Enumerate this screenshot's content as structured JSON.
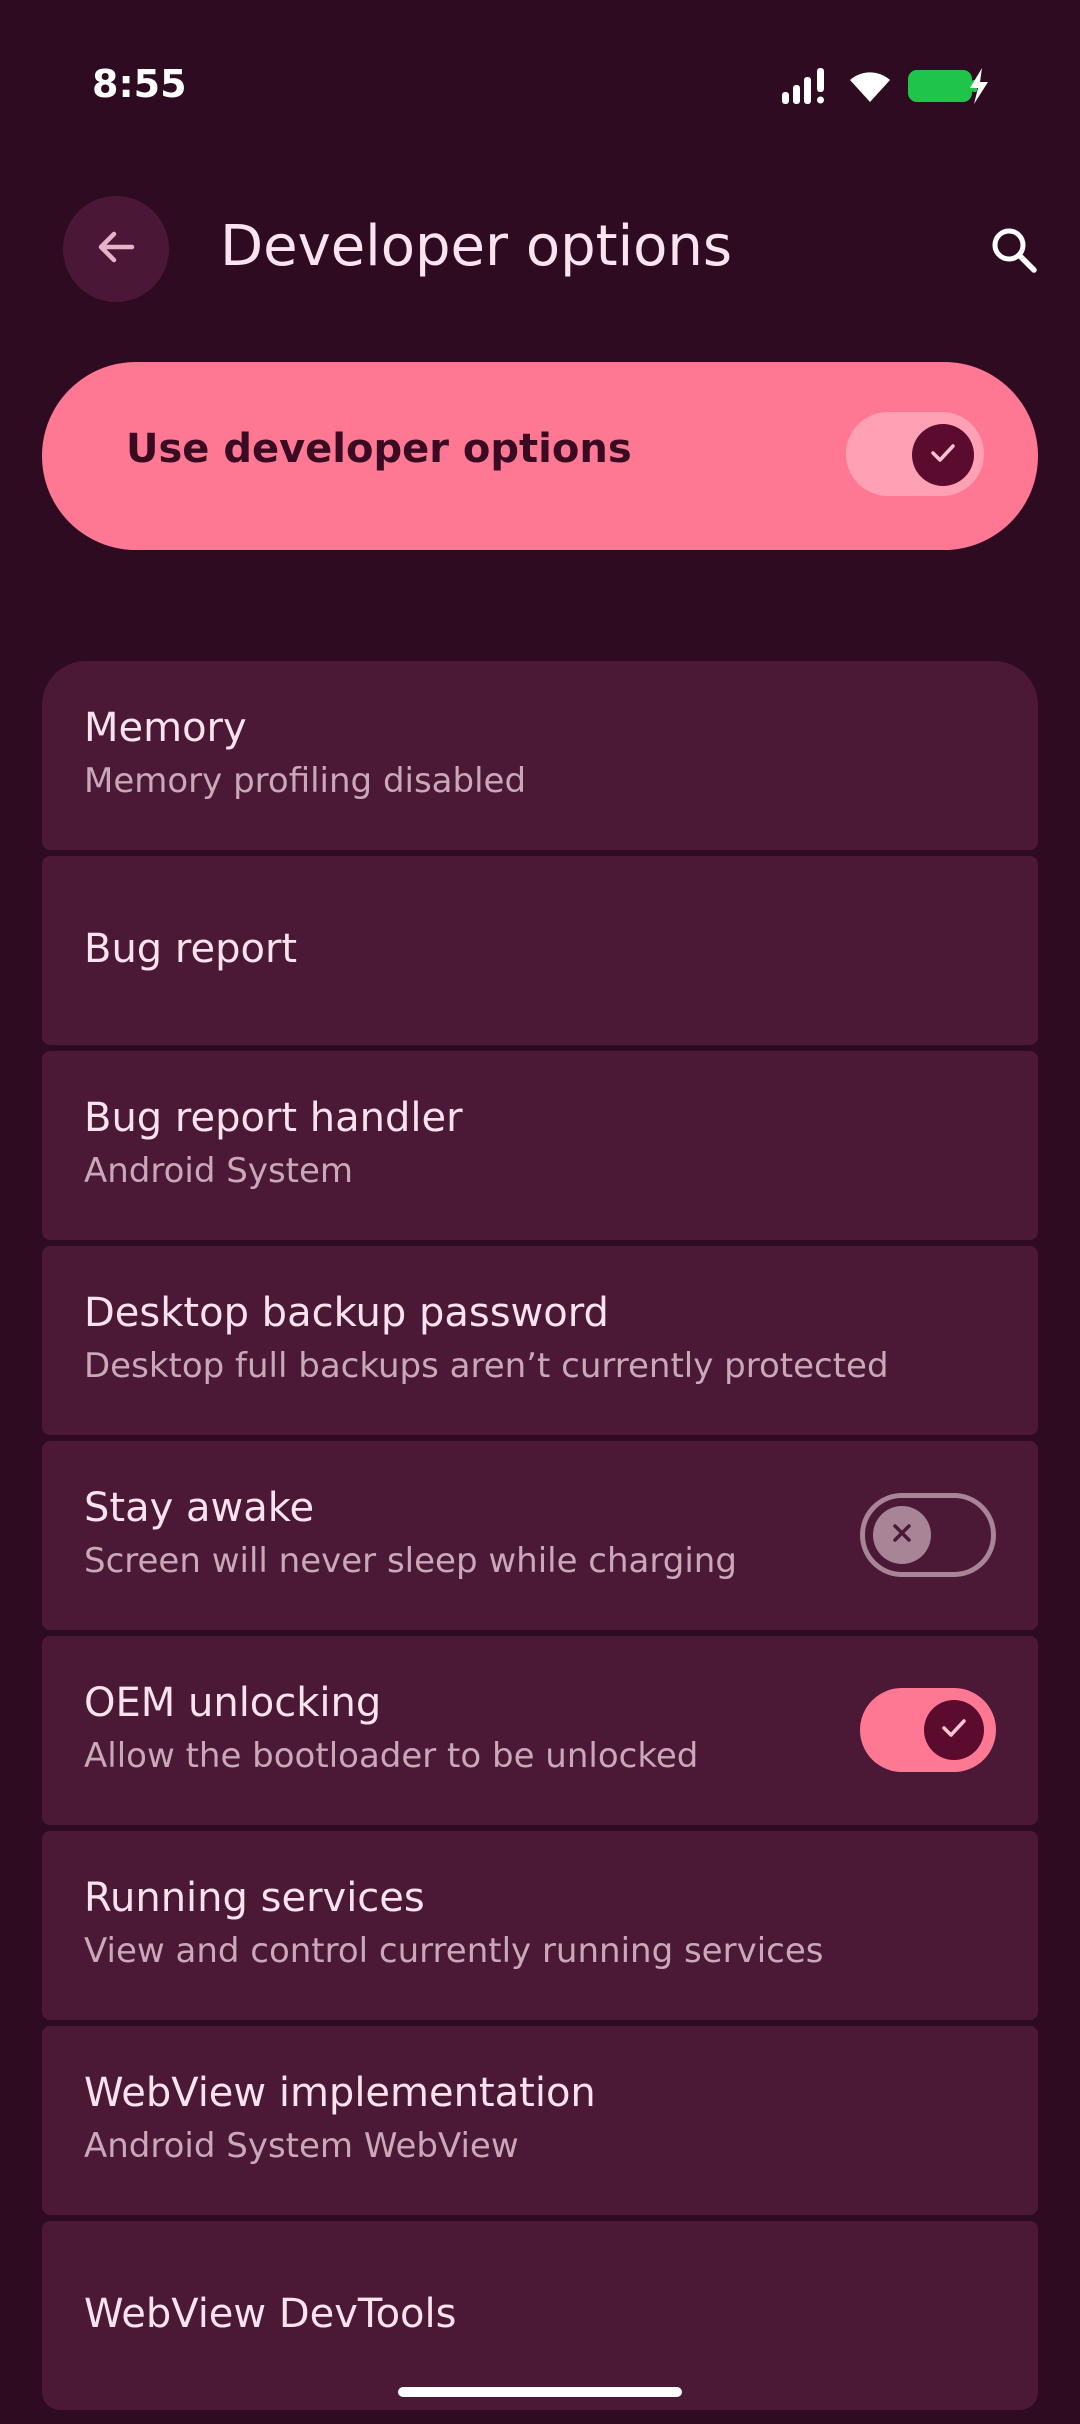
{
  "status_bar": {
    "time": "8:55",
    "icons": [
      "signal-icon",
      "wifi-icon",
      "battery-charging-icon"
    ],
    "battery_color": "#1fc44a"
  },
  "app_bar": {
    "title": "Developer options",
    "back_icon": "back-arrow-icon",
    "search_icon": "search-icon"
  },
  "master_toggle": {
    "label": "Use developer options",
    "enabled": true,
    "accent": "#ff7893"
  },
  "settings": [
    {
      "title": "Memory",
      "subtitle": "Memory profiling disabled"
    },
    {
      "title": "Bug report",
      "subtitle": ""
    },
    {
      "title": "Bug report handler",
      "subtitle": "Android System"
    },
    {
      "title": "Desktop backup password",
      "subtitle": "Desktop full backups aren’t currently protected"
    },
    {
      "title": "Stay awake",
      "subtitle": "Screen will never sleep while charging",
      "toggle": false
    },
    {
      "title": "OEM unlocking",
      "subtitle": "Allow the bootloader to be unlocked",
      "toggle": true
    },
    {
      "title": "Running services",
      "subtitle": "View and control currently running services"
    },
    {
      "title": "WebView implementation",
      "subtitle": "Android System WebView"
    },
    {
      "title": "WebView DevTools",
      "subtitle": ""
    }
  ]
}
